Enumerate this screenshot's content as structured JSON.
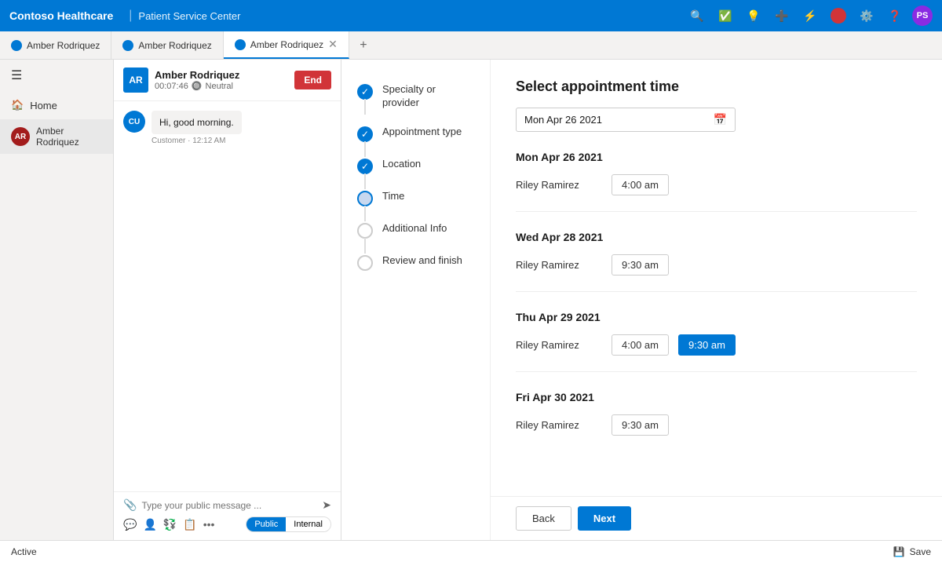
{
  "app": {
    "brand": "Contoso Healthcare",
    "subtitle": "Patient Service Center"
  },
  "topnav": {
    "icons": [
      "search",
      "checkmark-circle",
      "lightbulb",
      "plus",
      "filter",
      "settings",
      "help"
    ],
    "avatar_label": "PS",
    "red_badge": ""
  },
  "tabs": [
    {
      "label": "Amber Rodriquez",
      "active": false,
      "closeable": false
    },
    {
      "label": "Amber Rodriquez",
      "active": false,
      "closeable": false
    },
    {
      "label": "Amber Rodriquez",
      "active": true,
      "closeable": true
    }
  ],
  "sidebar": {
    "home_label": "Home",
    "agent_name": "Amber Rodriquez"
  },
  "chat": {
    "agent_initials": "AR",
    "contact_name": "Amber Rodriquez",
    "contact_initials": "CU",
    "timer": "00:07:46",
    "status": "Neutral",
    "end_label": "End",
    "message_text": "Hi, good morning.",
    "message_meta": "Customer · 12:12 AM",
    "input_placeholder": "Type your public message ...",
    "mode_public": "Public",
    "mode_internal": "Internal"
  },
  "steps": [
    {
      "label": "Specialty or provider",
      "state": "completed",
      "icon": "✓"
    },
    {
      "label": "Appointment type",
      "state": "completed",
      "icon": "✓"
    },
    {
      "label": "Location",
      "state": "completed",
      "icon": "✓"
    },
    {
      "label": "Time",
      "state": "active",
      "icon": ""
    },
    {
      "label": "Additional Info",
      "state": "inactive",
      "icon": ""
    },
    {
      "label": "Review and finish",
      "state": "inactive",
      "icon": ""
    }
  ],
  "appointment": {
    "title": "Select appointment time",
    "date_value": "Mon Apr 26 2021",
    "date_placeholder": "Mon Apr 26 2021",
    "groups": [
      {
        "date_heading": "Mon Apr 26 2021",
        "slots": [
          {
            "provider": "Riley Ramirez",
            "times": [
              "4:00 am"
            ],
            "selected": []
          }
        ]
      },
      {
        "date_heading": "Wed Apr 28 2021",
        "slots": [
          {
            "provider": "Riley Ramirez",
            "times": [
              "9:30 am"
            ],
            "selected": []
          }
        ]
      },
      {
        "date_heading": "Thu Apr 29 2021",
        "slots": [
          {
            "provider": "Riley Ramirez",
            "times": [
              "4:00 am",
              "9:30 am"
            ],
            "selected": [
              "9:30 am"
            ]
          }
        ]
      },
      {
        "date_heading": "Fri Apr 30 2021",
        "slots": [
          {
            "provider": "Riley Ramirez",
            "times": [
              "9:30 am"
            ],
            "selected": []
          }
        ]
      }
    ],
    "back_label": "Back",
    "next_label": "Next"
  },
  "statusbar": {
    "status_label": "Active",
    "save_label": "Save"
  }
}
